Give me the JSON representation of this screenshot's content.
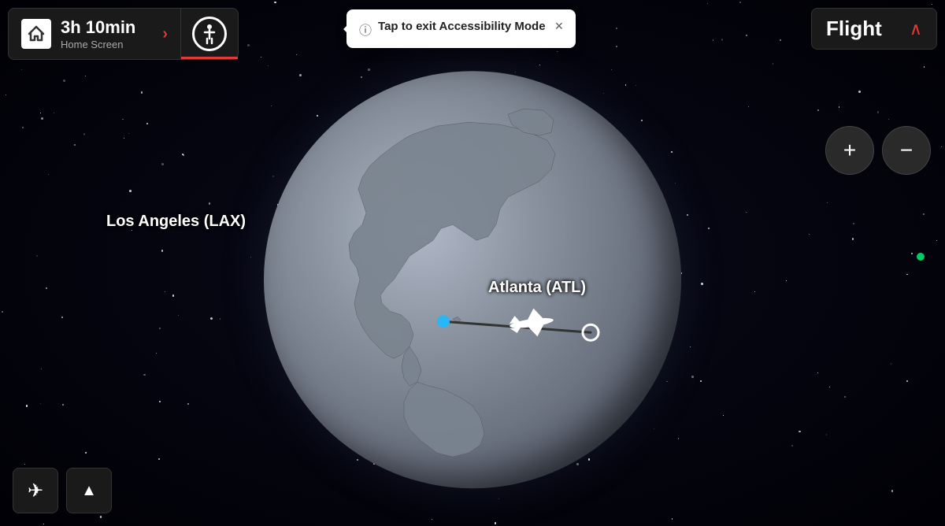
{
  "header": {
    "home_time": "3h 10min",
    "home_screen_label": "Home Screen",
    "home_arrow": "›",
    "flight_label": "Flight",
    "flight_chevron": "∧"
  },
  "accessibility": {
    "tooltip_text": "Tap to exit Accessibility Mode",
    "close_icon": "×",
    "info_icon": "ⓘ"
  },
  "zoom": {
    "plus_label": "+",
    "minus_label": "−"
  },
  "map": {
    "origin_city": "Los Angeles (LAX)",
    "destination_city": "Atlanta (ATL)"
  },
  "bottom_buttons": {
    "airplane_icon": "✈",
    "navigation_icon": "▲"
  }
}
